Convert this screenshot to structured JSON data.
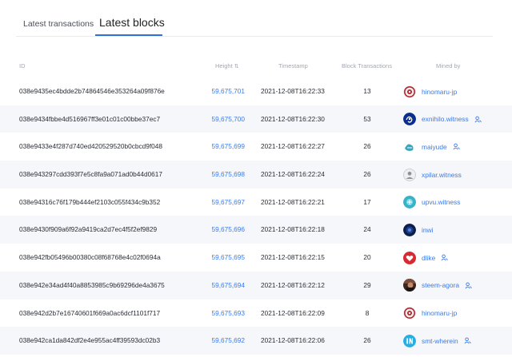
{
  "tabs": {
    "transactions": "Latest transactions",
    "blocks": "Latest blocks"
  },
  "columns": {
    "id": "ID",
    "height": "Height",
    "timestamp": "Timestamp",
    "block_transactions": "Block Transactions",
    "mined_by": "Mined by"
  },
  "colors": {
    "accent": "#2f6fe0",
    "link": "#3d7be8",
    "row_alt": "#f5f7fb"
  },
  "rows": [
    {
      "id": "038e9435ec4bdde2b74864546e353264a09f876e",
      "height": "59,675,701",
      "timestamp": "2021-12-08T16:22:33",
      "tx": "13",
      "miner": "hinomaru-jp",
      "avatar": "red-seal",
      "badge": false
    },
    {
      "id": "038e9434fbbe4d516967ff3e01c01c00bbe37ec7",
      "height": "59,675,700",
      "timestamp": "2021-12-08T16:22:30",
      "tx": "53",
      "miner": "exnihilo.witness",
      "avatar": "blue-swirl",
      "badge": true
    },
    {
      "id": "038e9433e4f287d740ed420529520b0cbcd9f048",
      "height": "59,675,699",
      "timestamp": "2021-12-08T16:22:27",
      "tx": "26",
      "miner": "maiyude",
      "avatar": "teal-logo",
      "badge": true
    },
    {
      "id": "038e943297cdd393f7e5c8fa9a071ad0b44d0617",
      "height": "59,675,698",
      "timestamp": "2021-12-08T16:22:24",
      "tx": "26",
      "miner": "xpilar.witness",
      "avatar": "grey-person",
      "badge": false
    },
    {
      "id": "038e94316c76f179b444ef2103c055f434c9b352",
      "height": "59,675,697",
      "timestamp": "2021-12-08T16:22:21",
      "tx": "17",
      "miner": "upvu.witness",
      "avatar": "teal-globe",
      "badge": false
    },
    {
      "id": "038e9430f909a6f92a9419ca2d7ec4f5f2ef9829",
      "height": "59,675,696",
      "timestamp": "2021-12-08T16:22:18",
      "tx": "24",
      "miner": "inwi",
      "avatar": "dark-blue",
      "badge": false
    },
    {
      "id": "038e942fb05496b00380c08f68768e4c02f0694a",
      "height": "59,675,695",
      "timestamp": "2021-12-08T16:22:15",
      "tx": "20",
      "miner": "dlike",
      "avatar": "red-heart",
      "badge": true
    },
    {
      "id": "038e942e34ad4f40a8853985c9b69296de4a3675",
      "height": "59,675,694",
      "timestamp": "2021-12-08T16:22:12",
      "tx": "29",
      "miner": "steem-agora",
      "avatar": "photo",
      "badge": true
    },
    {
      "id": "038e942d2b7e16740601f669a0ac6dcf1101f717",
      "height": "59,675,693",
      "timestamp": "2021-12-08T16:22:09",
      "tx": "8",
      "miner": "hinomaru-jp",
      "avatar": "red-seal",
      "badge": false
    },
    {
      "id": "038e942ca1da842df2e4e955ac4ff39593dc02b3",
      "height": "59,675,692",
      "timestamp": "2021-12-08T16:22:06",
      "tx": "26",
      "miner": "smt-wherein",
      "avatar": "teal-in",
      "badge": true
    }
  ]
}
